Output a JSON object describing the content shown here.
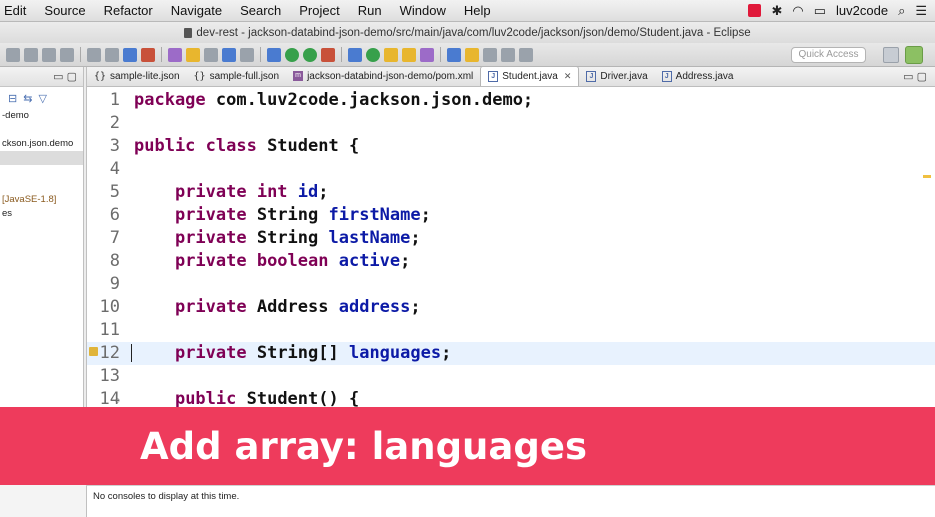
{
  "menubar": {
    "items": [
      "Edit",
      "Source",
      "Refactor",
      "Navigate",
      "Search",
      "Project",
      "Run",
      "Window",
      "Help"
    ],
    "user": "luv2code"
  },
  "window": {
    "title": "dev-rest - jackson-databind-json-demo/src/main/java/com/luv2code/jackson/json/demo/Student.java - Eclipse"
  },
  "toolbar": {
    "quick_access_placeholder": "Quick Access"
  },
  "explorer": {
    "items": [
      "-demo",
      "ckson.json.demo",
      "",
      "",
      "",
      "[JavaSE-1.8]",
      "es"
    ]
  },
  "tabs": [
    {
      "label": "sample-lite.json",
      "icon": "json-file-icon",
      "active": false
    },
    {
      "label": "sample-full.json",
      "icon": "json-file-icon",
      "active": false
    },
    {
      "label": "jackson-databind-json-demo/pom.xml",
      "icon": "maven-pom-icon",
      "active": false
    },
    {
      "label": "Student.java",
      "icon": "java-file-icon",
      "active": true
    },
    {
      "label": "Driver.java",
      "icon": "java-file-icon",
      "active": false
    },
    {
      "label": "Address.java",
      "icon": "java-file-icon",
      "active": false
    }
  ],
  "code": {
    "lines": [
      {
        "n": "1",
        "segs": [
          [
            "kw",
            "package "
          ],
          [
            "tx",
            "com.luv2code.jackson.json.demo;"
          ]
        ]
      },
      {
        "n": "2",
        "segs": []
      },
      {
        "n": "3",
        "segs": [
          [
            "kw",
            "public class "
          ],
          [
            "tx",
            "Student {"
          ]
        ]
      },
      {
        "n": "4",
        "segs": []
      },
      {
        "n": "5",
        "segs": [
          [
            "tx",
            "    "
          ],
          [
            "kw",
            "private int "
          ],
          [
            "fld",
            "id"
          ],
          [
            "tx",
            ";"
          ]
        ]
      },
      {
        "n": "6",
        "segs": [
          [
            "tx",
            "    "
          ],
          [
            "kw",
            "private "
          ],
          [
            "tx",
            "String "
          ],
          [
            "fld",
            "firstName"
          ],
          [
            "tx",
            ";"
          ]
        ]
      },
      {
        "n": "7",
        "segs": [
          [
            "tx",
            "    "
          ],
          [
            "kw",
            "private "
          ],
          [
            "tx",
            "String "
          ],
          [
            "fld",
            "lastName"
          ],
          [
            "tx",
            ";"
          ]
        ]
      },
      {
        "n": "8",
        "segs": [
          [
            "tx",
            "    "
          ],
          [
            "kw",
            "private boolean "
          ],
          [
            "fld",
            "active"
          ],
          [
            "tx",
            ";"
          ]
        ]
      },
      {
        "n": "9",
        "segs": []
      },
      {
        "n": "10",
        "segs": [
          [
            "tx",
            "    "
          ],
          [
            "kw",
            "private "
          ],
          [
            "tx",
            "Address "
          ],
          [
            "fld",
            "address"
          ],
          [
            "tx",
            ";"
          ]
        ]
      },
      {
        "n": "11",
        "segs": []
      },
      {
        "n": "12",
        "segs": [
          [
            "tx",
            "    "
          ],
          [
            "kw",
            "private "
          ],
          [
            "tx",
            "String[] "
          ],
          [
            "fld",
            "languages"
          ],
          [
            "tx",
            ";"
          ]
        ]
      },
      {
        "n": "13",
        "segs": []
      },
      {
        "n": "14",
        "segs": [
          [
            "tx",
            "    "
          ],
          [
            "kw",
            "public "
          ],
          [
            "tx",
            "Student() {"
          ]
        ]
      }
    ],
    "current_line": "12"
  },
  "caption": "Add array: languages",
  "console": {
    "message": "No consoles to display at this time."
  }
}
